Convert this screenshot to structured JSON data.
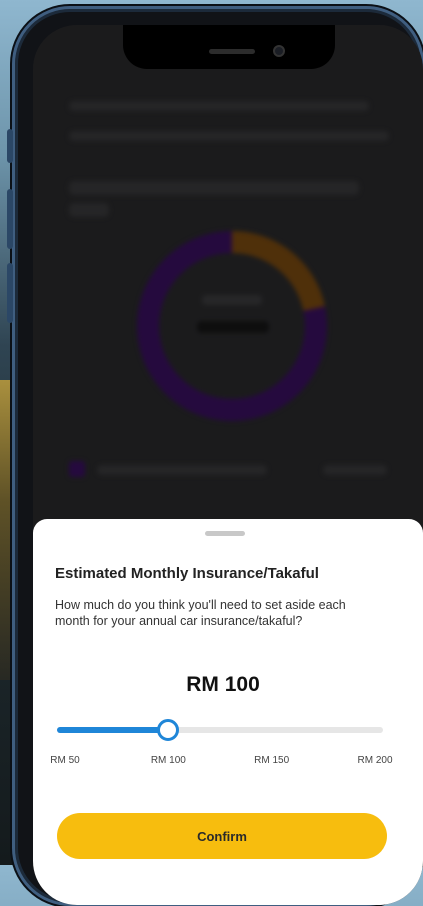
{
  "sheet": {
    "title": "Estimated Monthly Insurance/Takaful",
    "description": "How much do you think you'll need to set aside each month for your annual car insurance/takaful?",
    "amount": "RM 100",
    "confirm_label": "Confirm"
  },
  "slider": {
    "value": 100,
    "min": 50,
    "max": 200,
    "ticks": [
      "RM 50",
      "RM 100",
      "RM 150",
      "RM 200"
    ],
    "accent_color": "#1f86d8"
  },
  "colors": {
    "confirm_button": "#f7bd0e",
    "donut_primary": "#3a1060",
    "donut_secondary": "#7a4a10"
  }
}
